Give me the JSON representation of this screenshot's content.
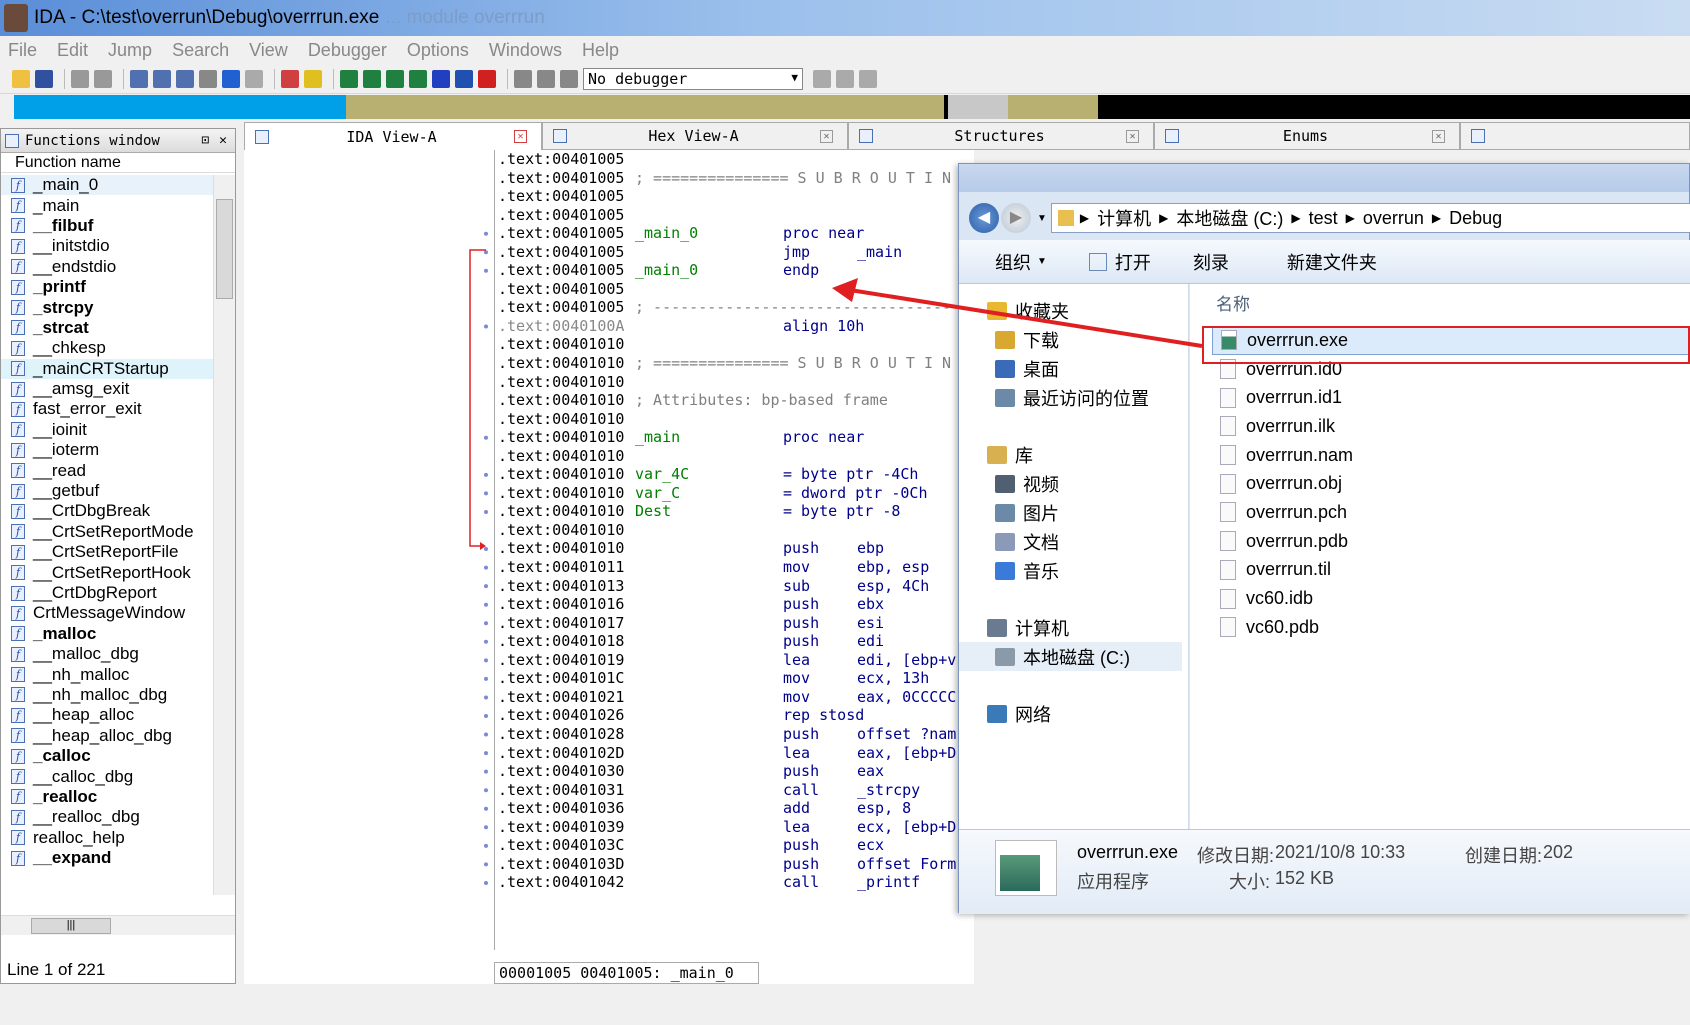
{
  "title": {
    "main": "IDA - C:\\test\\overrun\\Debug\\overrrun.exe",
    "ghost": "... module overrrun"
  },
  "menu": [
    "File",
    "Edit",
    "Jump",
    "Search",
    "View",
    "Debugger",
    "Options",
    "Windows",
    "Help"
  ],
  "toolbar": {
    "debugger_select": "No debugger"
  },
  "functions_window": {
    "title": "Functions window",
    "column": "Function name",
    "status": "Line 1 of 221",
    "items": [
      {
        "name": "_main_0",
        "bold": false
      },
      {
        "name": "_main",
        "bold": false
      },
      {
        "name": "__filbuf",
        "bold": true
      },
      {
        "name": "__initstdio",
        "bold": false
      },
      {
        "name": "__endstdio",
        "bold": false
      },
      {
        "name": "_printf",
        "bold": true
      },
      {
        "name": "_strcpy",
        "bold": true
      },
      {
        "name": "_strcat",
        "bold": true
      },
      {
        "name": "__chkesp",
        "bold": false
      },
      {
        "name": "_mainCRTStartup",
        "bold": false
      },
      {
        "name": "__amsg_exit",
        "bold": false
      },
      {
        "name": "fast_error_exit",
        "bold": false
      },
      {
        "name": "__ioinit",
        "bold": false
      },
      {
        "name": "__ioterm",
        "bold": false
      },
      {
        "name": "__read",
        "bold": false
      },
      {
        "name": "__getbuf",
        "bold": false
      },
      {
        "name": "__CrtDbgBreak",
        "bold": false
      },
      {
        "name": "__CrtSetReportMode",
        "bold": false
      },
      {
        "name": "__CrtSetReportFile",
        "bold": false
      },
      {
        "name": "__CrtSetReportHook",
        "bold": false
      },
      {
        "name": "__CrtDbgReport",
        "bold": false
      },
      {
        "name": "CrtMessageWindow",
        "bold": false
      },
      {
        "name": "_malloc",
        "bold": true
      },
      {
        "name": "__malloc_dbg",
        "bold": false
      },
      {
        "name": "__nh_malloc",
        "bold": false
      },
      {
        "name": "__nh_malloc_dbg",
        "bold": false
      },
      {
        "name": "__heap_alloc",
        "bold": false
      },
      {
        "name": "__heap_alloc_dbg",
        "bold": false
      },
      {
        "name": "_calloc",
        "bold": true
      },
      {
        "name": "__calloc_dbg",
        "bold": false
      },
      {
        "name": "_realloc",
        "bold": true
      },
      {
        "name": "__realloc_dbg",
        "bold": false
      },
      {
        "name": "realloc_help",
        "bold": false
      },
      {
        "name": "__expand",
        "bold": true
      }
    ]
  },
  "tabs": [
    {
      "label": "IDA View-A"
    },
    {
      "label": "Hex View-A"
    },
    {
      "label": "Structures"
    },
    {
      "label": "Enums"
    }
  ],
  "code_status": "00001005 00401005: _main_0",
  "code_lines": [
    {
      "addr": ".text:00401005"
    },
    {
      "addr": ".text:00401005",
      "cm": "; =============== S U B R O U T I N"
    },
    {
      "addr": ".text:00401005"
    },
    {
      "addr": ".text:00401005"
    },
    {
      "addr": ".text:00401005",
      "lbl": "_main_0",
      "mn": "proc near"
    },
    {
      "addr": ".text:00401005",
      "mn": "jmp",
      "op": "_main"
    },
    {
      "addr": ".text:00401005",
      "lbl": "_main_0",
      "mn": "endp"
    },
    {
      "addr": ".text:00401005"
    },
    {
      "addr": ".text:00401005",
      "cm": "; ---------------------------------"
    },
    {
      "addr": ".text:0040100A",
      "mn": "align 10h",
      "gray": true
    },
    {
      "addr": ".text:00401010"
    },
    {
      "addr": ".text:00401010",
      "cm": "; =============== S U B R O U T I N"
    },
    {
      "addr": ".text:00401010"
    },
    {
      "addr": ".text:00401010",
      "cm": "; Attributes: bp-based frame"
    },
    {
      "addr": ".text:00401010"
    },
    {
      "addr": ".text:00401010",
      "lbl": "_main",
      "mn": "proc near"
    },
    {
      "addr": ".text:00401010"
    },
    {
      "addr": ".text:00401010",
      "lbl": "var_4C",
      "mn": "= byte ptr -4Ch"
    },
    {
      "addr": ".text:00401010",
      "lbl": "var_C",
      "mn": "= dword ptr -0Ch"
    },
    {
      "addr": ".text:00401010",
      "lbl": "Dest",
      "mn": "= byte ptr -8"
    },
    {
      "addr": ".text:00401010"
    },
    {
      "addr": ".text:00401010",
      "mn": "push",
      "op": "ebp"
    },
    {
      "addr": ".text:00401011",
      "mn": "mov",
      "op": "ebp, esp"
    },
    {
      "addr": ".text:00401013",
      "mn": "sub",
      "op": "esp, 4Ch"
    },
    {
      "addr": ".text:00401016",
      "mn": "push",
      "op": "ebx"
    },
    {
      "addr": ".text:00401017",
      "mn": "push",
      "op": "esi"
    },
    {
      "addr": ".text:00401018",
      "mn": "push",
      "op": "edi"
    },
    {
      "addr": ".text:00401019",
      "mn": "lea",
      "op": "edi, [ebp+v"
    },
    {
      "addr": ".text:0040101C",
      "mn": "mov",
      "op": "ecx, 13h"
    },
    {
      "addr": ".text:00401021",
      "mn": "mov",
      "op": "eax, 0CCCCC"
    },
    {
      "addr": ".text:00401026",
      "mn": "rep stosd"
    },
    {
      "addr": ".text:00401028",
      "mn": "push",
      "op": "offset ?nam"
    },
    {
      "addr": ".text:0040102D",
      "mn": "lea",
      "op": "eax, [ebp+D"
    },
    {
      "addr": ".text:00401030",
      "mn": "push",
      "op": "eax"
    },
    {
      "addr": ".text:00401031",
      "mn": "call",
      "op": "_strcpy"
    },
    {
      "addr": ".text:00401036",
      "mn": "add",
      "op": "esp, 8"
    },
    {
      "addr": ".text:00401039",
      "mn": "lea",
      "op": "ecx, [ebp+D"
    },
    {
      "addr": ".text:0040103C",
      "mn": "push",
      "op": "ecx"
    },
    {
      "addr": ".text:0040103D",
      "mn": "push",
      "op": "offset Form"
    },
    {
      "addr": ".text:00401042",
      "mn": "call",
      "op": "_printf"
    }
  ],
  "explorer": {
    "breadcrumbs": [
      "计算机",
      "本地磁盘 (C:)",
      "test",
      "overrun",
      "Debug"
    ],
    "commands": [
      "组织",
      "打开",
      "刻录",
      "新建文件夹"
    ],
    "nav": [
      {
        "label": "收藏夹",
        "indent": 0,
        "color": "#e8b830"
      },
      {
        "label": "下载",
        "indent": 1,
        "color": "#d8a830"
      },
      {
        "label": "桌面",
        "indent": 1,
        "color": "#3a6ab8"
      },
      {
        "label": "最近访问的位置",
        "indent": 1,
        "color": "#6a8aa8"
      },
      {
        "label": "",
        "indent": 0,
        "color": ""
      },
      {
        "label": "库",
        "indent": 0,
        "color": "#d8b050"
      },
      {
        "label": "视频",
        "indent": 1,
        "color": "#506070"
      },
      {
        "label": "图片",
        "indent": 1,
        "color": "#6a8aa8"
      },
      {
        "label": "文档",
        "indent": 1,
        "color": "#8a9ab8"
      },
      {
        "label": "音乐",
        "indent": 1,
        "color": "#3a7ad8"
      },
      {
        "label": "",
        "indent": 0,
        "color": ""
      },
      {
        "label": "计算机",
        "indent": 0,
        "color": "#6a7a90"
      },
      {
        "label": "本地磁盘 (C:)",
        "indent": 1,
        "color": "#8a9aa8"
      },
      {
        "label": "",
        "indent": 0,
        "color": ""
      },
      {
        "label": "网络",
        "indent": 0,
        "color": "#3a7ab8"
      }
    ],
    "column_name": "名称",
    "files": [
      "overrrun.exe",
      "overrrun.id0",
      "overrrun.id1",
      "overrrun.ilk",
      "overrrun.nam",
      "overrrun.obj",
      "overrrun.pch",
      "overrrun.pdb",
      "overrrun.til",
      "vc60.idb",
      "vc60.pdb"
    ],
    "details": {
      "filename": "overrrun.exe",
      "type": "应用程序",
      "modified_label": "修改日期:",
      "modified": "2021/10/8 10:33",
      "size_label": "大小:",
      "size": "152 KB",
      "created_label": "创建日期:",
      "created": "202"
    }
  },
  "colors": {
    "arrow": "#e02020",
    "label": "#008000",
    "mnemonic": "#00008b",
    "navband_code": "#00a0e8",
    "navband_data": "#b8b070"
  }
}
